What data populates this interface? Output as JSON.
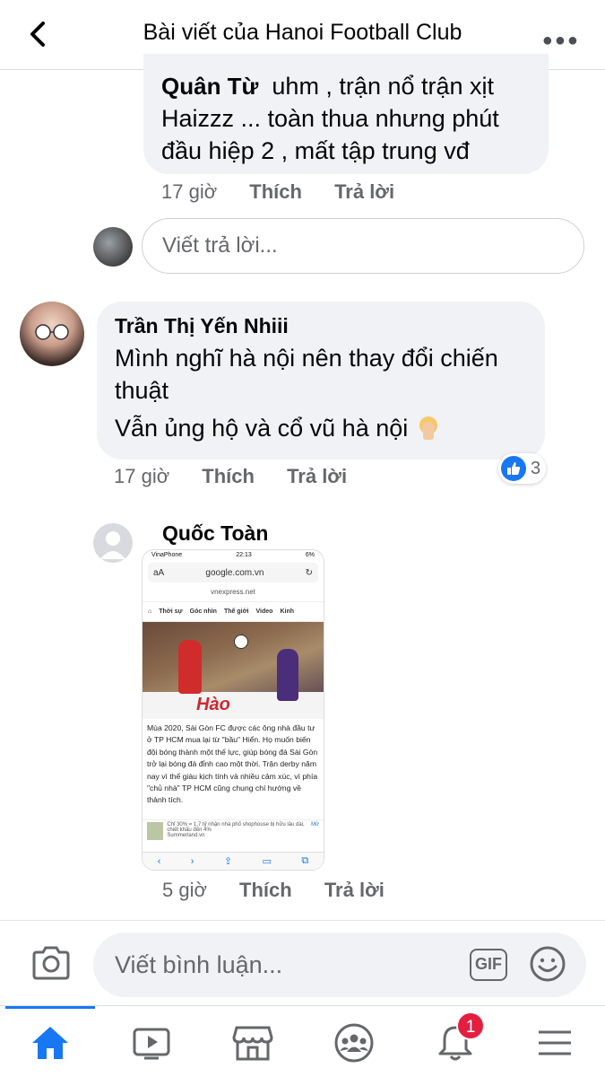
{
  "header": {
    "title": "Bài viết của Hanoi Football Club"
  },
  "comments": [
    {
      "author": "Quân Từ",
      "text_line1": "uhm , trận nổ trận xịt",
      "text_line2": "Haizzz ... toàn thua nhưng phút",
      "text_line3": "đầu hiệp 2 , mất tập trung vđ",
      "time": "17 giờ",
      "like_label": "Thích",
      "reply_label": "Trả lời"
    },
    {
      "author": "Trần Thị Yến Nhiii",
      "text_line1": "Mình nghĩ hà nội nên thay đổi chiến",
      "text_line2": "thuật",
      "text_line3": "Vẫn ủng hộ và cổ vũ hà nội",
      "time": "17 giờ",
      "like_label": "Thích",
      "reply_label": "Trả lời",
      "reaction_count": "3"
    },
    {
      "author": "Quốc Toàn",
      "time": "5 giờ",
      "like_label": "Thích",
      "reply_label": "Trả lời"
    }
  ],
  "reply_box": {
    "placeholder": "Viết trả lời..."
  },
  "screenshot": {
    "carrier": "VinaPhone",
    "time": "22:13",
    "battery": "6%",
    "url": "google.com.vn",
    "site": "vnexpress.net",
    "nav": [
      "Thời sự",
      "Góc nhìn",
      "Thế giới",
      "Video",
      "Kinh"
    ],
    "brand": "Hào",
    "article": "Mùa 2020, Sài Gòn FC được các ông nhà đầu tư ở TP HCM mua lại từ \"bầu\" Hiển. Họ muốn biến đội bóng thành một thế lực, giúp bóng đá Sài Gòn trở lại bóng đá đỉnh cao một thời. Trận derby năm nay vì thế giàu kịch tính và nhiều cảm xúc, vì phía \"chủ nhà\" TP HCM cũng chung chí hướng về thành tích.",
    "ad_text": "Chỉ 30% = 1,7 tỷ nhận nhà phố shophouse bị hữu lâu dài, chiết khấu đến 4%",
    "ad_site": "Summerland.vn",
    "ad_more": "Mở"
  },
  "composer": {
    "placeholder": "Viết bình luận...",
    "gif_label": "GIF"
  },
  "tabbar": {
    "notification_badge": "1"
  }
}
